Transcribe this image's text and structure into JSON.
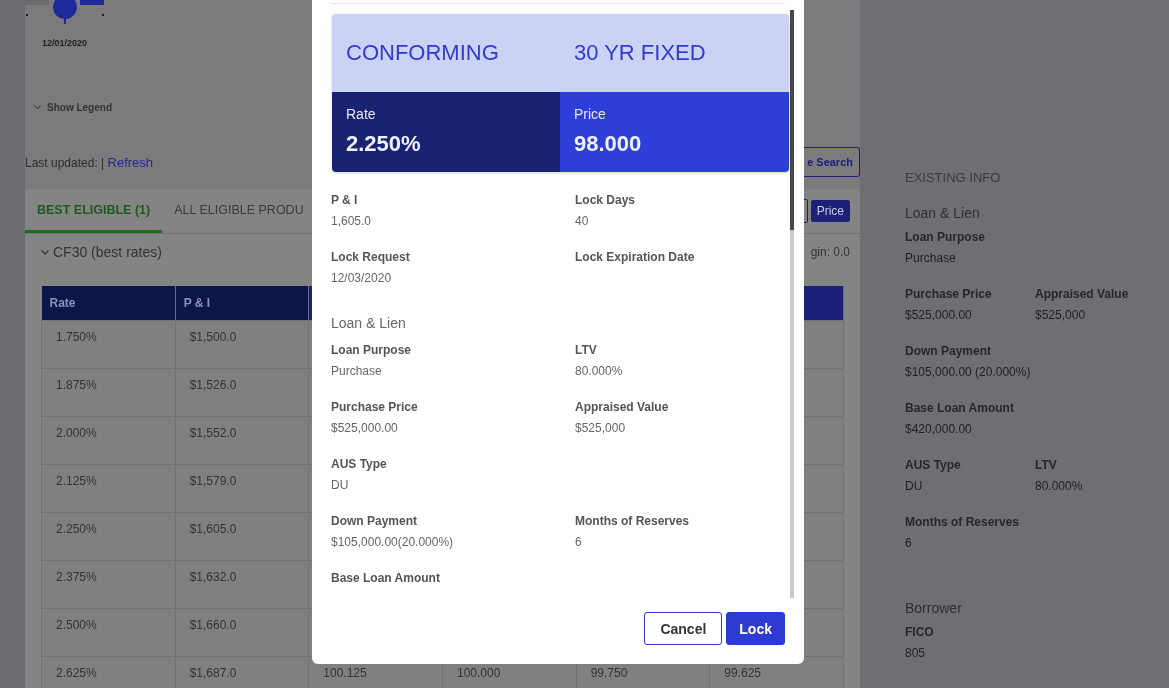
{
  "chart": {
    "date_label": "12/01/2020"
  },
  "legend_toggle": {
    "label": "Show Legend"
  },
  "last_updated": {
    "label": "Last updated: |",
    "link": "Refresh"
  },
  "search_button": {
    "label": "e Search"
  },
  "tabs": [
    {
      "label": "BEST ELIGIBLE (1)",
      "selected": true
    },
    {
      "label": "ALL ELIGIBLE PRODU",
      "selected": false
    }
  ],
  "price_button": {
    "label": "Price",
    "selected": true
  },
  "group": {
    "title": "CF30 (best rates)",
    "margin_text": "gin: 0.0"
  },
  "table": {
    "columns": [
      "Rate",
      "P & I"
    ],
    "rows": [
      {
        "rate": "1.750%",
        "p_and_i": "$1,500.0"
      },
      {
        "rate": "1.875%",
        "p_and_i": "$1,526.0"
      },
      {
        "rate": "2.000%",
        "p_and_i": "$1,552.0"
      },
      {
        "rate": "2.125%",
        "p_and_i": "$1,579.0"
      },
      {
        "rate": "2.250%",
        "p_and_i": "$1,605.0"
      },
      {
        "rate": "2.375%",
        "p_and_i": "$1,632.0"
      },
      {
        "rate": "2.500%",
        "p_and_i": "$1,660.0"
      },
      {
        "rate": "2.625%",
        "p_and_i": "$1,687.0",
        "column_3": "100.125",
        "column_4": "100.000",
        "column_5": "99.750",
        "column_6": "99.625"
      }
    ]
  },
  "modal": {
    "product": "CONFORMING",
    "term": "30 YR FIXED",
    "rate": {
      "label": "Rate",
      "value": "2.250%"
    },
    "price": {
      "label": "Price",
      "value": "98.000"
    },
    "sections": [
      {
        "rows": [
          [
            {
              "label": "P & I",
              "value": "1,605.0"
            },
            {
              "label": "Lock Days",
              "value": "40"
            }
          ],
          [
            {
              "label": "Lock Request",
              "value": "12/03/2020"
            },
            {
              "label": "Lock Expiration Date"
            }
          ]
        ]
      },
      {
        "title": "Loan & Lien",
        "rows": [
          [
            {
              "label": "Loan Purpose",
              "value": "Purchase"
            },
            {
              "label": "LTV",
              "value": "80.000%"
            }
          ],
          [
            {
              "label": "Purchase Price",
              "value": "$525,000.00"
            },
            {
              "label": "Appraised Value",
              "value": "$525,000"
            }
          ],
          [
            {
              "label": "AUS Type",
              "value": "DU"
            }
          ],
          [
            {
              "label": "Down Payment",
              "value": "$105,000.00(20.000%)"
            },
            {
              "label": "Months of Reserves",
              "value": "6"
            }
          ],
          [
            {
              "label": "Base Loan Amount"
            }
          ]
        ]
      }
    ],
    "buttons": [
      {
        "label": "Cancel",
        "kind": "secondary"
      },
      {
        "label": "Lock",
        "kind": "primary"
      }
    ]
  },
  "existing_info": {
    "title": "EXISTING INFO",
    "sections": [
      {
        "title": "Loan & Lien",
        "rows": [
          [
            {
              "label": "Loan Purpose",
              "value": "Purchase"
            }
          ],
          [
            {
              "label": "Purchase Price",
              "value": "$525,000.00"
            },
            {
              "label": "Appraised Value",
              "value": "$525,000"
            }
          ],
          [
            {
              "label": "Down Payment",
              "value": "$105,000.00 (20.000%)"
            }
          ],
          [
            {
              "label": "Base Loan Amount",
              "value": "$420,000.00"
            }
          ],
          [
            {
              "label": "AUS Type",
              "value": "DU"
            },
            {
              "label": "LTV",
              "value": "80.000%"
            }
          ],
          [
            {
              "label": "Months of Reserves",
              "value": "6"
            }
          ]
        ]
      },
      {
        "title": "Borrower",
        "rows": [
          [
            {
              "label": "FICO",
              "value": "805"
            }
          ]
        ]
      }
    ]
  }
}
